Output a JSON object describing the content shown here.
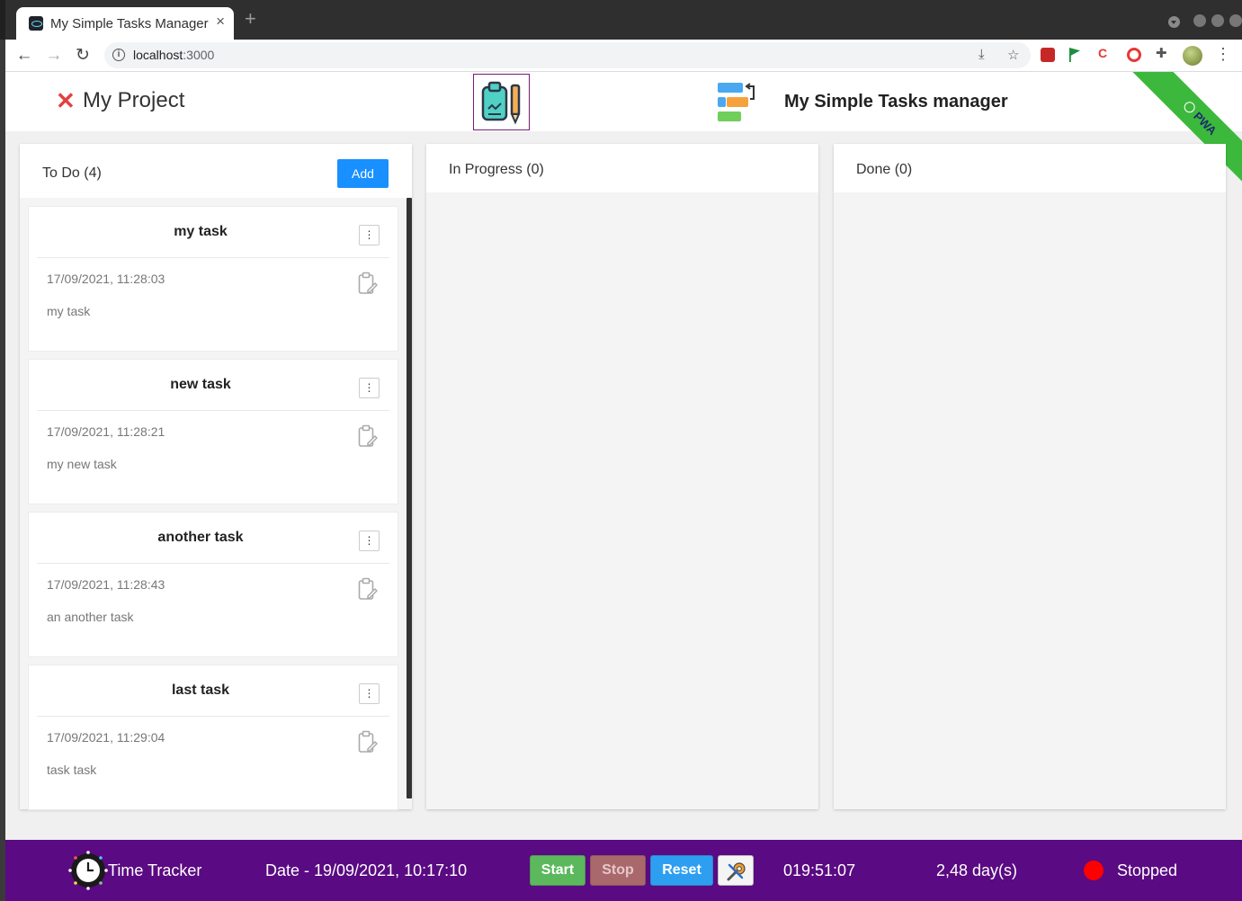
{
  "browser": {
    "tab_title": "My Simple Tasks Manager",
    "url_host": "localhost",
    "url_port": ":3000"
  },
  "header": {
    "project_title": "My Project",
    "app_title": "My Simple Tasks manager",
    "ribbon_text": "PWA"
  },
  "columns": [
    {
      "title": "To Do (4)",
      "add_label": "Add",
      "cards": [
        {
          "title": "my task",
          "date": "17/09/2021, 11:28:03",
          "description": "my task"
        },
        {
          "title": "new task",
          "date": "17/09/2021, 11:28:21",
          "description": "my new task"
        },
        {
          "title": "another task",
          "date": "17/09/2021, 11:28:43",
          "description": "an another task"
        },
        {
          "title": "last task",
          "date": "17/09/2021, 11:29:04",
          "description": "task task"
        }
      ]
    },
    {
      "title": "In Progress (0)"
    },
    {
      "title": "Done (0)"
    }
  ],
  "footer": {
    "label": "Time Tracker",
    "date": "Date - 19/09/2021, 10:17:10",
    "start_label": "Start",
    "stop_label": "Stop",
    "reset_label": "Reset",
    "elapsed": "019:51:07",
    "days": "2,48 day(s)",
    "status": "Stopped",
    "status_color": "#ff0000"
  },
  "colors": {
    "accent": "#1890ff",
    "footer_bg": "#5a0a82",
    "ribbon": "#3cb93c",
    "close_x": "#e53f3f"
  }
}
